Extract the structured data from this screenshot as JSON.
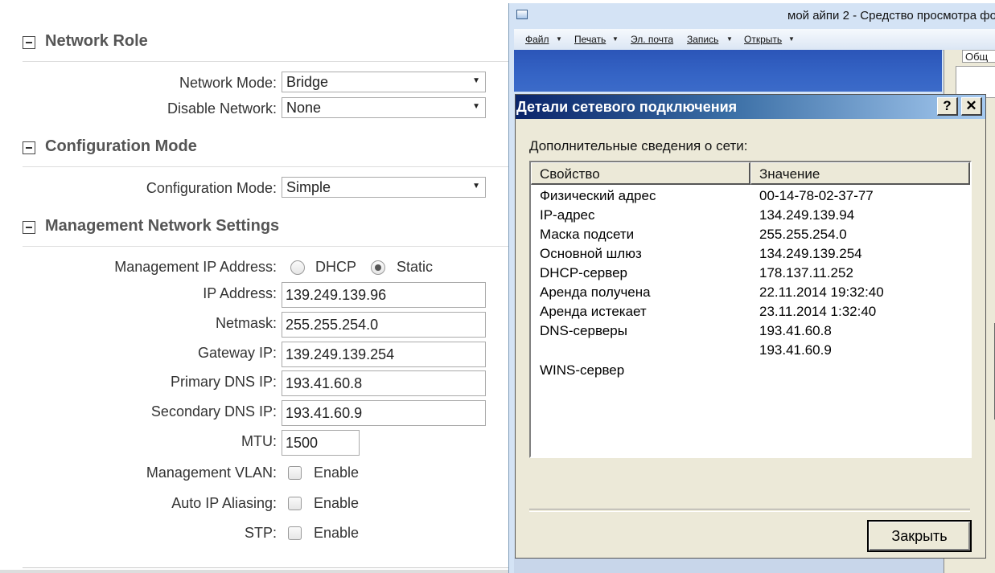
{
  "router": {
    "network_role": {
      "title": "Network Role",
      "network_mode": {
        "label": "Network Mode:",
        "value": "Bridge"
      },
      "disable_network": {
        "label": "Disable Network:",
        "value": "None"
      }
    },
    "configuration_mode": {
      "title": "Configuration Mode",
      "mode": {
        "label": "Configuration Mode:",
        "value": "Simple"
      }
    },
    "management": {
      "title": "Management Network Settings",
      "ip_type": {
        "label": "Management IP Address:",
        "dhcp": "DHCP",
        "static": "Static",
        "selected": "Static"
      },
      "ip_address": {
        "label": "IP Address:",
        "value": "139.249.139.96"
      },
      "netmask": {
        "label": "Netmask:",
        "value": "255.255.254.0"
      },
      "gateway": {
        "label": "Gateway IP:",
        "value": "139.249.139.254"
      },
      "primary_dns": {
        "label": "Primary DNS IP:",
        "value": "193.41.60.8"
      },
      "secondary_dns": {
        "label": "Secondary DNS IP:",
        "value": "193.41.60.9"
      },
      "mtu": {
        "label": "MTU:",
        "value": "1500"
      },
      "vlan": {
        "label": "Management VLAN:",
        "option": "Enable",
        "checked": false
      },
      "aliasing": {
        "label": "Auto IP Aliasing:",
        "option": "Enable",
        "checked": false
      },
      "stp": {
        "label": "STP:",
        "option": "Enable",
        "checked": false
      }
    }
  },
  "viewer": {
    "title": "мой айпи 2 - Средство просмотра фо",
    "menu": [
      "Файл",
      "Печать",
      "Эл. почта",
      "Запись",
      "Открыть"
    ],
    "side_fragment": "Общ"
  },
  "dialog": {
    "title": "Детали сетевого подключения",
    "help_label": "?",
    "close_label": "✕",
    "subtitle": "Дополнительные сведения о сети:",
    "columns": {
      "property": "Свойство",
      "value": "Значение"
    },
    "rows": [
      {
        "property": "Физический адрес",
        "value": "00-14-78-02-37-77"
      },
      {
        "property": "IP-адрес",
        "value": "134.249.139.94"
      },
      {
        "property": "Маска подсети",
        "value": "255.255.254.0"
      },
      {
        "property": "Основной шлюз",
        "value": "134.249.139.254"
      },
      {
        "property": "DHCP-сервер",
        "value": "178.137.11.252"
      },
      {
        "property": "Аренда получена",
        "value": "22.11.2014 19:32:40"
      },
      {
        "property": "Аренда истекает",
        "value": "23.11.2014 1:32:40"
      },
      {
        "property": "DNS-серверы",
        "value": "193.41.60.8"
      },
      {
        "property": "",
        "value": "193.41.60.9"
      },
      {
        "property": "WINS-сервер",
        "value": ""
      }
    ],
    "close_button": "Закрыть"
  },
  "colors": {
    "section_title": "#555555",
    "dialog_title_start": "#0a246a",
    "dialog_title_end": "#a6caf0",
    "photo_blue": "#3564c5",
    "dialog_bg": "#ece9d8"
  }
}
